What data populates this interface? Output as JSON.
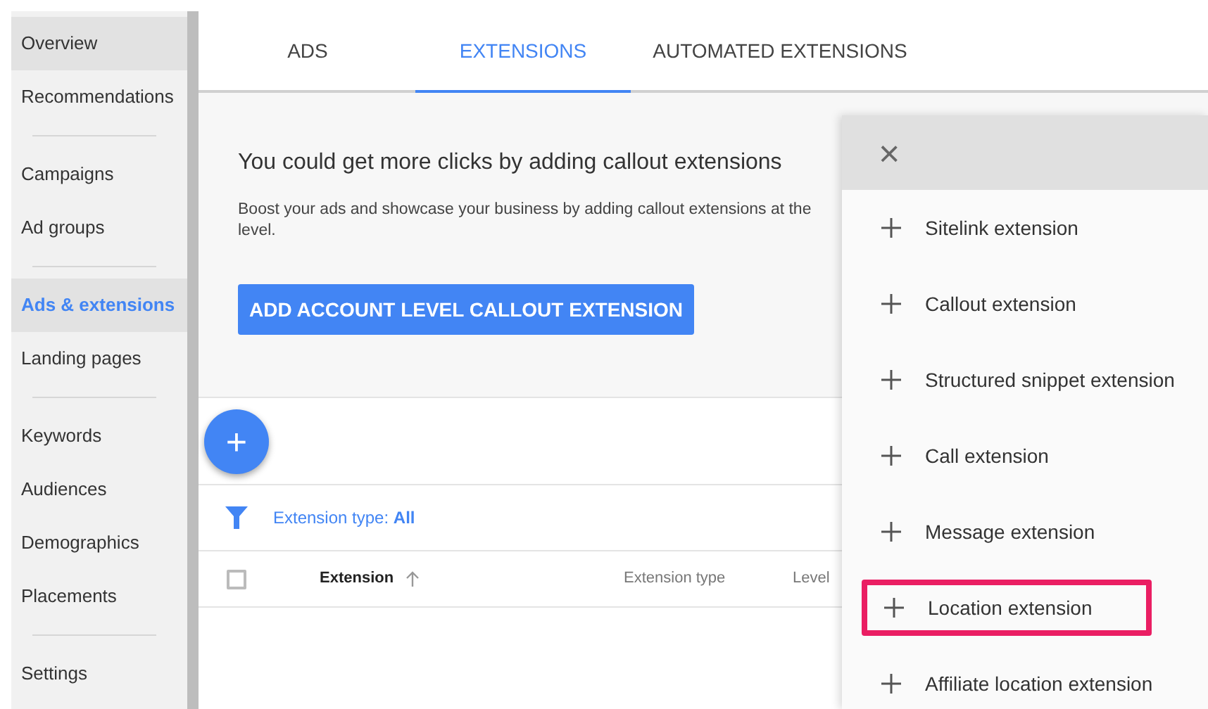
{
  "sidebar": {
    "groups": [
      [
        {
          "label": "Overview",
          "selected": false,
          "hovered": true
        },
        {
          "label": "Recommendations",
          "selected": false,
          "hovered": false
        }
      ],
      [
        {
          "label": "Campaigns",
          "selected": false,
          "hovered": false
        },
        {
          "label": "Ad groups",
          "selected": false,
          "hovered": false
        }
      ],
      [
        {
          "label": "Ads & extensions",
          "selected": true,
          "hovered": false
        },
        {
          "label": "Landing pages",
          "selected": false,
          "hovered": false
        }
      ],
      [
        {
          "label": "Keywords",
          "selected": false,
          "hovered": false
        },
        {
          "label": "Audiences",
          "selected": false,
          "hovered": false
        },
        {
          "label": "Demographics",
          "selected": false,
          "hovered": false
        },
        {
          "label": "Placements",
          "selected": false,
          "hovered": false
        }
      ],
      [
        {
          "label": "Settings",
          "selected": false,
          "hovered": false
        }
      ]
    ]
  },
  "tabs": [
    {
      "label": "ADS",
      "selected": false
    },
    {
      "label": "EXTENSIONS",
      "selected": true
    },
    {
      "label": "AUTOMATED EXTENSIONS",
      "selected": false
    }
  ],
  "banner": {
    "title": "You could get more clicks by adding callout extensions",
    "description_lines": [
      "Boost your ads and showcase your business by adding callout extensions at the",
      "level."
    ],
    "button": "ADD ACCOUNT LEVEL CALLOUT EXTENSION"
  },
  "add_button": "+",
  "filter": {
    "label": "Extension type:",
    "value": "All"
  },
  "table": {
    "select_all_checked": false,
    "columns": [
      {
        "label": "Extension",
        "sorted": true
      },
      {
        "label": "Extension type",
        "sorted": false
      },
      {
        "label": "Level",
        "sorted": false
      }
    ]
  },
  "panel": {
    "close": "×",
    "items": [
      {
        "label": "Sitelink extension",
        "highlighted": false
      },
      {
        "label": "Callout extension",
        "highlighted": false
      },
      {
        "label": "Structured snippet extension",
        "highlighted": false
      },
      {
        "label": "Call extension",
        "highlighted": false
      },
      {
        "label": "Message extension",
        "highlighted": false
      },
      {
        "label": "Location extension",
        "highlighted": true
      },
      {
        "label": "Affiliate location extension",
        "highlighted": false
      }
    ]
  }
}
